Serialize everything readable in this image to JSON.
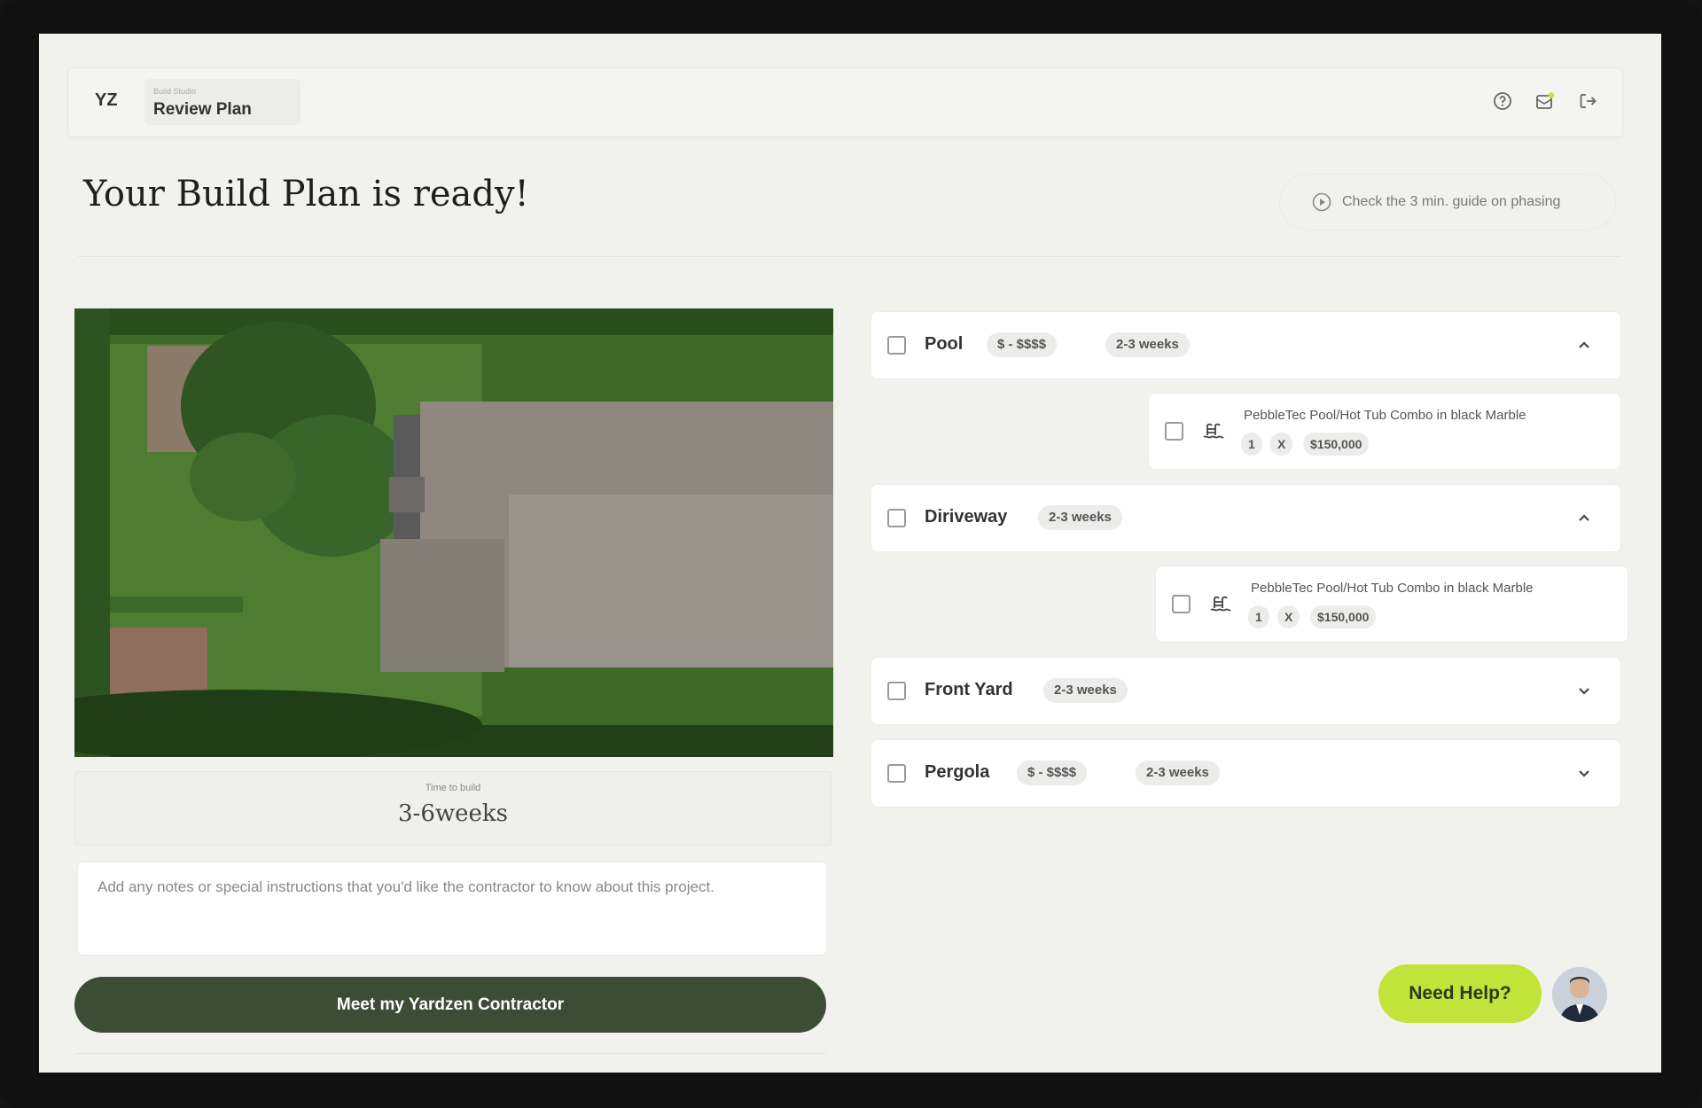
{
  "header": {
    "logo": "YZ",
    "breadcrumb_small": "Build Studio",
    "breadcrumb_title": "Review Plan",
    "icons": [
      "help-icon",
      "notification-icon",
      "logout-icon"
    ]
  },
  "page": {
    "title": "Your Build Plan is ready!",
    "guide_label": "Check the 3 min. guide on phasing"
  },
  "plan": {
    "time_label": "Time to build",
    "time_value": "3-6weeks",
    "notes_placeholder": "Add any notes or special instructions that you'd like the contractor to know about this project.",
    "cta_label": "Meet my Yardzen Contractor"
  },
  "items": [
    {
      "label": "Pool",
      "price": "$ - $$$$",
      "duration": "2-3 weeks",
      "expanded": true,
      "sub": {
        "title": "PebbleTec Pool/Hot Tub Combo in black Marble",
        "qty": "1",
        "times": "X",
        "price": "$150,000"
      }
    },
    {
      "label": "Diriveway",
      "duration": "2-3 weeks",
      "expanded": true,
      "sub": {
        "title": "PebbleTec Pool/Hot Tub Combo in black Marble",
        "qty": "1",
        "times": "X",
        "price": "$150,000"
      }
    },
    {
      "label": "Front Yard",
      "duration": "2-3 weeks",
      "expanded": false
    },
    {
      "label": "Pergola",
      "price": "$ - $$$$",
      "duration": "2-3 weeks",
      "expanded": false
    }
  ],
  "help": {
    "label": "Need Help?"
  }
}
